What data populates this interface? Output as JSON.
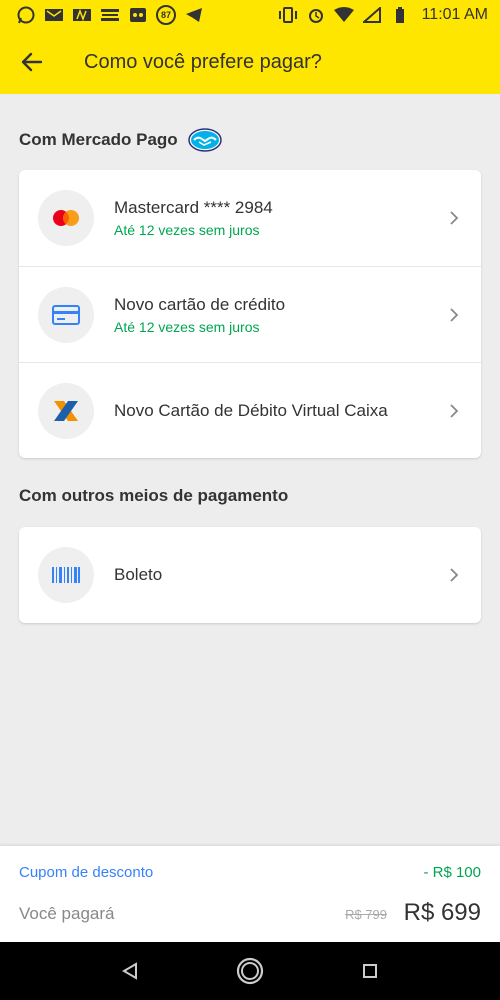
{
  "status_bar": {
    "time": "11:01 AM",
    "badge": "87"
  },
  "header": {
    "title": "Como você prefere pagar?"
  },
  "mercado_pago_section": {
    "title": "Com Mercado Pago",
    "items": [
      {
        "icon": "mastercard-icon",
        "title": "Mastercard **** 2984",
        "subtitle": "Até 12 vezes sem juros"
      },
      {
        "icon": "credit-card-icon",
        "title": "Novo cartão de crédito",
        "subtitle": "Até 12 vezes sem juros"
      },
      {
        "icon": "caixa-logo-icon",
        "title": "Novo Cartão de Débito Virtual Caixa"
      }
    ]
  },
  "other_section": {
    "title": "Com outros meios de pagamento",
    "items": [
      {
        "icon": "barcode-icon",
        "title": "Boleto"
      }
    ]
  },
  "footer": {
    "coupon_label": "Cupom de desconto",
    "coupon_value": "- R$ 100",
    "pay_label": "Você pagará",
    "old_price": "R$ 799",
    "new_price": "R$ 699"
  },
  "colors": {
    "brand_yellow": "#ffe600",
    "green": "#00a650",
    "link_blue": "#3483fa"
  }
}
